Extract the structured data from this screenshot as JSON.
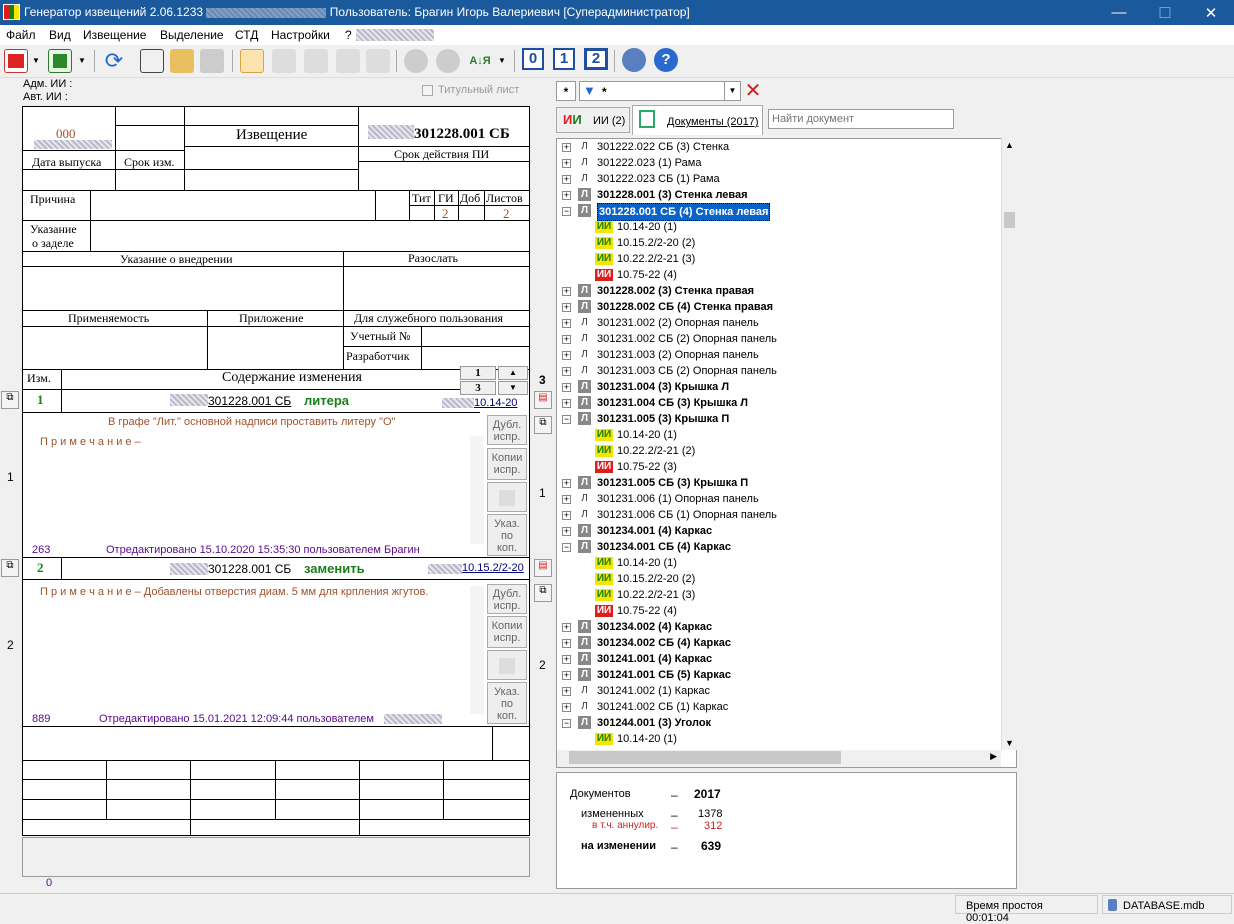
{
  "window": {
    "title": "Генератор извещений 2.06.1233",
    "user": "Пользователь: Брагин Игорь Валериевич [Суперадминистратор]"
  },
  "menu": [
    "Файл",
    "Вид",
    "Извещение",
    "Выделение",
    "СТД",
    "Настройки",
    "?"
  ],
  "toolbar": {
    "page_buttons": [
      "0",
      "1",
      "2"
    ]
  },
  "header": {
    "adm": "Адм. ИИ :",
    "avt": "Авт. ИИ :",
    "title_sheet": "Титульный лист"
  },
  "form": {
    "code": "000",
    "izveshchenie": "Извещение",
    "doc_number": "301228.001 СБ",
    "date_issue": "Дата выпуска",
    "change_term": "Срок изм.",
    "validity": "Срок действия ПИ",
    "reason": "Причина",
    "tit": "Тит",
    "gi": "ГИ",
    "dob": "Доб",
    "sheets": "Листов",
    "gi_value": "2",
    "sheets_value": "2",
    "backlog1": "Указание",
    "backlog2": "о заделе",
    "implementation": "Указание о внедрении",
    "send": "Разослать",
    "applicability": "Применяемость",
    "attachment": "Приложение",
    "official": "Для служебного пользования",
    "account_no": "Учетный №",
    "developer": "Разработчик",
    "izm": "Изм.",
    "content": "Содержание изменения",
    "nav_top": "1",
    "nav_bottom": "3",
    "page_total": "3"
  },
  "changes": [
    {
      "num": "1",
      "doc": "301228.001 СБ",
      "action": "литера",
      "ref": "10.14-20",
      "text": "В графе \"Лит.\" основной надписи проставить литеру \"О\"",
      "note": "П р и м е ч а н и е –",
      "counter": "263",
      "edited": "Отредактировано  15.10.2020 15:35:30  пользователем  Брагин",
      "side": "1"
    },
    {
      "num": "2",
      "doc": "301228.001 СБ",
      "action": "заменить",
      "ref": "10.15.2/2-20",
      "text": "",
      "note": "П р и м е ч а н и е –  Добавлены отверстия диам. 5 мм для крпления жгутов.",
      "counter": "889",
      "edited": "Отредактировано  15.01.2021 12:09:44  пользователем",
      "side": "2"
    }
  ],
  "side_buttons": {
    "dubl1": "Дубл.",
    "dubl2": "испр.",
    "copy1": "Копии",
    "copy2": "испр.",
    "ukaz1": "Указ.",
    "ukaz2": "по",
    "ukaz3": "коп."
  },
  "footer_counter": "0",
  "right": {
    "filter_value": "*",
    "tab_ii": "ИИ (2)",
    "tab_docs": "Документы (2017)",
    "search_placeholder": "Найти документ"
  },
  "tree": [
    {
      "t": "301222.022 СБ (3) Стенка",
      "k": "L",
      "b": false
    },
    {
      "t": "301222.023 (1) Рама",
      "k": "L",
      "b": false
    },
    {
      "t": "301222.023 СБ (1) Рама",
      "k": "L",
      "b": false
    },
    {
      "t": "301228.001 (3) Стенка левая",
      "k": "L",
      "b": true
    },
    {
      "t": "301228.001 СБ (4) Стенка левая",
      "k": "L",
      "b": true,
      "sel": true,
      "open": true
    },
    {
      "t": "10.14-20 (1)",
      "k": "y"
    },
    {
      "t": "10.15.2/2-20 (2)",
      "k": "y"
    },
    {
      "t": "10.22.2/2-21 (3)",
      "k": "y"
    },
    {
      "t": "10.75-22 (4)",
      "k": "r"
    },
    {
      "t": "301228.002 (3) Стенка правая",
      "k": "L",
      "b": true
    },
    {
      "t": "301228.002 СБ (4) Стенка правая",
      "k": "L",
      "b": true
    },
    {
      "t": "301231.002 (2) Опорная панель",
      "k": "L",
      "b": false
    },
    {
      "t": "301231.002 СБ (2) Опорная панель",
      "k": "L",
      "b": false
    },
    {
      "t": "301231.003 (2) Опорная панель",
      "k": "L",
      "b": false
    },
    {
      "t": "301231.003 СБ (2) Опорная панель",
      "k": "L",
      "b": false
    },
    {
      "t": "301231.004 (3) Крышка Л",
      "k": "L",
      "b": true
    },
    {
      "t": "301231.004 СБ (3) Крышка Л",
      "k": "L",
      "b": true
    },
    {
      "t": "301231.005 (3) Крышка П",
      "k": "L",
      "b": true,
      "open": true
    },
    {
      "t": "10.14-20 (1)",
      "k": "y"
    },
    {
      "t": "10.22.2/2-21 (2)",
      "k": "y"
    },
    {
      "t": "10.75-22 (3)",
      "k": "r"
    },
    {
      "t": "301231.005 СБ (3) Крышка П",
      "k": "L",
      "b": true
    },
    {
      "t": "301231.006 (1) Опорная панель",
      "k": "L",
      "b": false
    },
    {
      "t": "301231.006 СБ (1) Опорная панель",
      "k": "L",
      "b": false
    },
    {
      "t": "301234.001 (4) Каркас",
      "k": "L",
      "b": true
    },
    {
      "t": "301234.001 СБ (4) Каркас",
      "k": "L",
      "b": true,
      "open": true
    },
    {
      "t": "10.14-20 (1)",
      "k": "y"
    },
    {
      "t": "10.15.2/2-20 (2)",
      "k": "y"
    },
    {
      "t": "10.22.2/2-21 (3)",
      "k": "y"
    },
    {
      "t": "10.75-22 (4)",
      "k": "r"
    },
    {
      "t": "301234.002 (4) Каркас",
      "k": "L",
      "b": true
    },
    {
      "t": "301234.002 СБ (4) Каркас",
      "k": "L",
      "b": true
    },
    {
      "t": "301241.001 (4) Каркас",
      "k": "L",
      "b": true
    },
    {
      "t": "301241.001 СБ (5) Каркас",
      "k": "L",
      "b": true
    },
    {
      "t": "301241.002 (1) Каркас",
      "k": "L",
      "b": false
    },
    {
      "t": "301241.002 СБ (1) Каркас",
      "k": "L",
      "b": false
    },
    {
      "t": "301244.001 (3) Уголок",
      "k": "L",
      "b": true,
      "open": true
    },
    {
      "t": "10.14-20 (1)",
      "k": "y"
    }
  ],
  "ii_label": "ИИ",
  "l_label": "Л",
  "stats": {
    "docs_label": "Документов",
    "docs_value": "2017",
    "changed_label": "измененных",
    "changed_value": "1378",
    "annul_label": "в т.ч. аннулир.",
    "annul_value": "312",
    "onchange_label": "на изменении",
    "onchange_value": "639",
    "dash": "–"
  },
  "status": {
    "idle": "Время простоя 00:01:04",
    "db": "DATABASE.mdb"
  }
}
